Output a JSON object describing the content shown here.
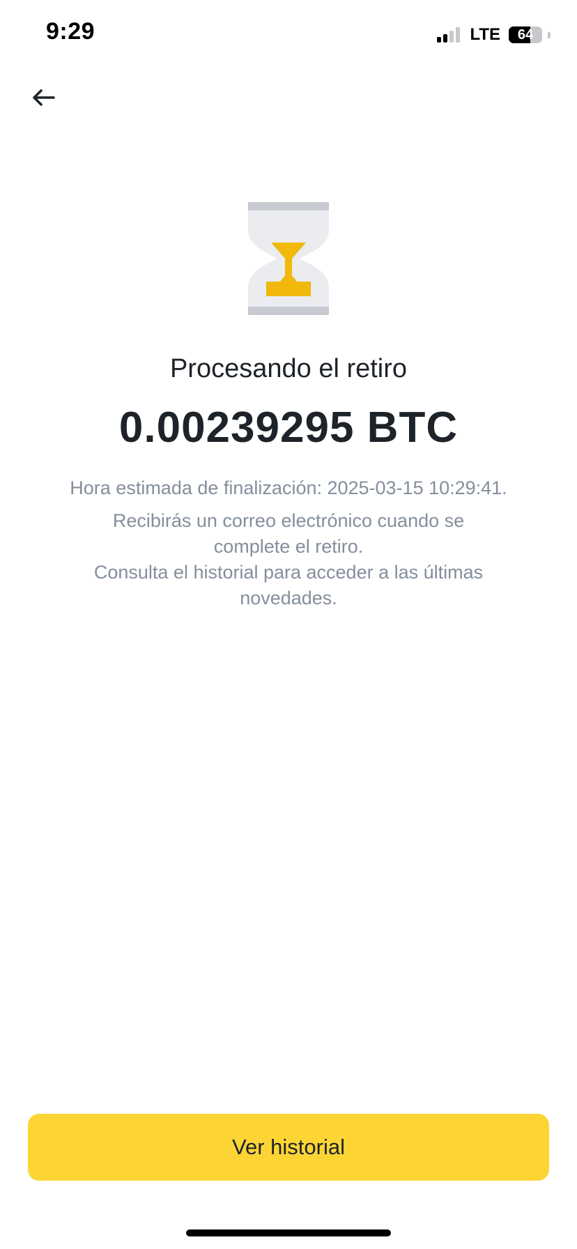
{
  "status_bar": {
    "time": "9:29",
    "network": "LTE",
    "battery_percent": "64",
    "signal_bars_active": 2,
    "signal_bars_total": 4
  },
  "icons": {
    "back": "arrow-left-icon",
    "status": "hourglass-icon"
  },
  "withdrawal": {
    "title": "Procesando el retiro",
    "amount": "0.00239295 BTC",
    "eta": "Hora estimada de finalización: 2025-03-15 10:29:41.",
    "email_notice": "Recibirás un correo electrónico cuando se complete el retiro.",
    "history_notice": "Consulta el historial para acceder a las últimas novedades."
  },
  "actions": {
    "history_button": "Ver historial"
  },
  "colors": {
    "accent": "#fcd535",
    "hourglass_sand": "#f0b90b",
    "text_primary": "#1e2329",
    "text_secondary": "#848e9c"
  }
}
